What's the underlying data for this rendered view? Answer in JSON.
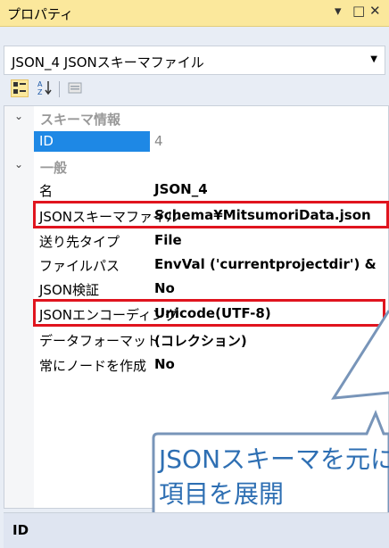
{
  "panel": {
    "title": "プロパティ",
    "controls": [
      "▾",
      "□",
      "✕"
    ]
  },
  "object_selector": {
    "value": "JSON_4 JSONスキーマファイル"
  },
  "toolbar": {
    "buttons": [
      {
        "icon": "categorized-icon"
      },
      {
        "icon": "alphabetical-sort-icon"
      },
      {
        "icon": "property-pages-icon"
      }
    ]
  },
  "categories": [
    {
      "label": "スキーマ情報",
      "properties": [
        {
          "name": "ID",
          "value": "4"
        }
      ]
    },
    {
      "label": "一般",
      "properties": [
        {
          "name": "名",
          "value": "JSON_4"
        },
        {
          "name": "JSONスキーマファイル",
          "value": "Schema¥MitsumoriData.json"
        },
        {
          "name": "送り先タイプ",
          "value": "File"
        },
        {
          "name": "ファイルパス",
          "value": "EnvVal ('currentprojectdir') &"
        },
        {
          "name": "JSON検証",
          "value": "No"
        },
        {
          "name": "JSONエンコーディング",
          "value": "Unicode(UTF-8)"
        },
        {
          "name": "データフォーマット",
          "value": "(コレクション)"
        },
        {
          "name": "常にノードを作成",
          "value": "No"
        }
      ]
    }
  ],
  "description": {
    "title": "ID"
  },
  "callout": {
    "line1": "JSONスキーマを元に",
    "line2": "項目を展開",
    "border_color": "#7895b9"
  },
  "highlight_color": "#e0141e",
  "selection_color": "#1e88e5"
}
